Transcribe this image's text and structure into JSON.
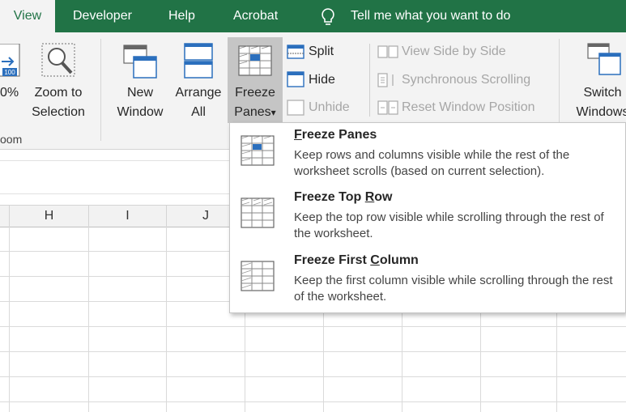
{
  "tabs": [
    {
      "label": "View",
      "active": true
    },
    {
      "label": "Developer"
    },
    {
      "label": "Help"
    },
    {
      "label": "Acrobat"
    }
  ],
  "tell_me": "Tell me what you want to do",
  "ribbon": {
    "zoom100": {
      "line1": "0%"
    },
    "zoom_to_selection": {
      "line1": "Zoom to",
      "line2": "Selection"
    },
    "new_window": {
      "line1": "New",
      "line2": "Window"
    },
    "arrange_all": {
      "line1": "Arrange",
      "line2": "All"
    },
    "freeze_panes": {
      "line1": "Freeze",
      "line2": "Panes",
      "arrow": "▾"
    },
    "split": "Split",
    "hide": "Hide",
    "unhide": "Unhide",
    "view_side_by_side": "View Side by Side",
    "synchronous_scrolling": "Synchronous Scrolling",
    "reset_window_position": "Reset Window Position",
    "switch_windows": {
      "line1": "Switch",
      "line2": "Windows"
    },
    "zoom_group": "oom",
    "icon_badge": "100"
  },
  "columns": [
    "H",
    "I",
    "J"
  ],
  "dropdown": {
    "items": [
      {
        "title_accel": "F",
        "title_rest": "reeze Panes",
        "desc": "Keep rows and columns visible while the rest of the worksheet scrolls (based on current selection)."
      },
      {
        "title_pre": "Freeze Top ",
        "title_accel": "R",
        "title_rest": "ow",
        "desc": "Keep the top row visible while scrolling through the rest of the worksheet."
      },
      {
        "title_pre": "Freeze First ",
        "title_accel": "C",
        "title_rest": "olumn",
        "desc": "Keep the first column visible while scrolling through the rest of the worksheet."
      }
    ]
  },
  "colors": {
    "brand": "#217346",
    "accent_blue": "#2b6fbd"
  }
}
